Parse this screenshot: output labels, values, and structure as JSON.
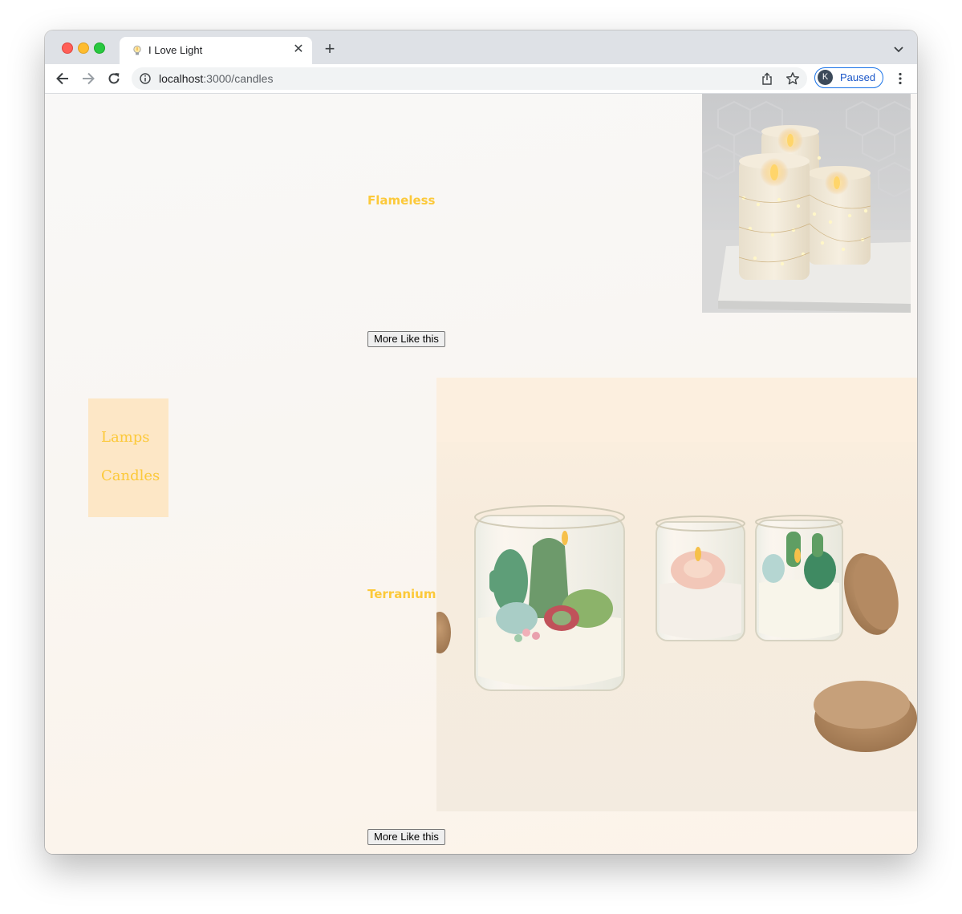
{
  "browser": {
    "tab": {
      "title": "I Love Light",
      "favicon": "lightbulb-icon"
    },
    "address": {
      "host": "localhost",
      "path": ":3000/candles"
    },
    "profile": {
      "initial": "K",
      "status": "Paused"
    }
  },
  "nav": {
    "items": [
      {
        "label": "Lamps"
      },
      {
        "label": "Candles"
      }
    ]
  },
  "products": [
    {
      "title": "Flameless",
      "button_label": "More Like this",
      "image": "flameless-candles-photo"
    },
    {
      "title": "Terranium",
      "button_label": "More Like this",
      "image": "terranium-candles-photo"
    }
  ],
  "colors": {
    "accent": "#fcc93a",
    "sidenav_bg": "#fde7c6",
    "page_bg": "#f9f7f3",
    "tabstrip_bg": "#dee1e6",
    "profile_blue": "#1a73e8"
  }
}
